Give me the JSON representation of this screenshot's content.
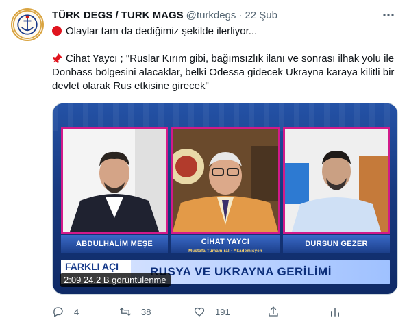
{
  "tweet": {
    "author_name": "TÜRK DEGS / TURK MAGS",
    "author_handle": "@turkdegs",
    "separator": "·",
    "date": "22 Şub",
    "line1": "Olaylar tam da dediğimiz şekilde ilerliyor...",
    "line2": "Cihat Yaycı ; \"Ruslar Kırım gibi, bağımsızlık ilanı ve sonrası ilhak yolu ile",
    "line3": "Donbass bölgesini alacaklar, belki Odessa gidecek Ukrayna karaya kilitli bir",
    "line4": "devlet olarak Rus etkisine girecek\""
  },
  "video": {
    "guest_left": "ABDULHALİM MEŞE",
    "guest_center": "CİHAT YAYCI",
    "guest_center_title": "Mustafa Tümamiral · Akademisyen",
    "guest_right": "DURSUN GEZER",
    "banner_left": "FARKLI AÇI",
    "banner_title": "RUSYA VE UKRAYNA GERİLİMİ",
    "time_views": "2:09 24,2 B görüntülenme"
  },
  "actions": {
    "reply_count": "4",
    "retweet_count": "38",
    "like_count": "191"
  },
  "colors": {
    "accent_pink": "#d21a8a",
    "text_muted": "#536471",
    "red_dot": "#e0141e"
  }
}
